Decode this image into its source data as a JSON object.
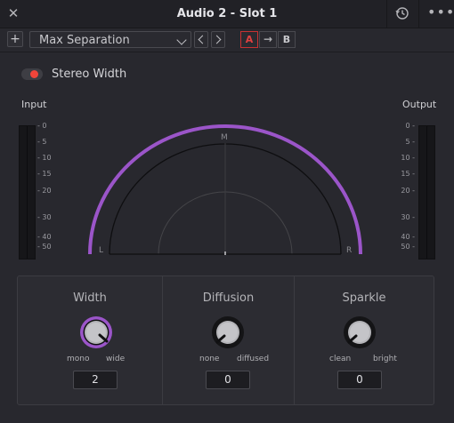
{
  "titlebar": {
    "title": "Audio 2 - Slot 1",
    "close_glyph": "✕",
    "history_icon": "history-icon",
    "more_glyph": "•••"
  },
  "toolbar": {
    "add_glyph": "+",
    "preset_value": "Max Separation",
    "ab": {
      "a_label": "A",
      "copy_glyph": "→",
      "b_label": "B"
    }
  },
  "stereo_width_toggle": {
    "label": "Stereo Width",
    "on": true
  },
  "meters": {
    "input_label": "Input",
    "output_label": "Output",
    "ticks": [
      "- 0",
      "- 5",
      "- 10",
      "- 15",
      "- 20",
      "- 30",
      "- 40",
      "- 50"
    ],
    "output_ticks": [
      "0 -",
      "5 -",
      "10 -",
      "15 -",
      "20 -",
      "30 -",
      "40 -",
      "50 -"
    ]
  },
  "scope": {
    "label_m": "M",
    "label_l": "L",
    "label_r": "R",
    "arc_color": "#9b55c9"
  },
  "controls": [
    {
      "title": "Width",
      "min_label": "mono",
      "max_label": "wide",
      "value": "2",
      "active": true
    },
    {
      "title": "Diffusion",
      "min_label": "none",
      "max_label": "diffused",
      "value": "0",
      "active": false
    },
    {
      "title": "Sparkle",
      "min_label": "clean",
      "max_label": "bright",
      "value": "0",
      "active": false
    }
  ],
  "colors": {
    "accent_purple": "#9b55c9",
    "toggle_red": "#f0453a",
    "a_red": "#e04040"
  }
}
